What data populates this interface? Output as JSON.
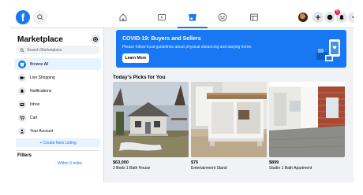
{
  "topbar": {
    "logo": "f",
    "nav_icons": [
      "home-icon",
      "watch-icon",
      "marketplace-icon",
      "groups-icon",
      "gaming-icon"
    ],
    "right_icons": [
      "plus-icon",
      "messenger-icon",
      "notifications-icon",
      "chevron-down-icon"
    ],
    "notification_count": "5"
  },
  "sidebar": {
    "title": "Marketplace",
    "search_placeholder": "Search Marketplace",
    "items": [
      {
        "label": "Browse All",
        "icon": "storefront-icon"
      },
      {
        "label": "Live Shopping",
        "icon": "live-icon"
      },
      {
        "label": "Notifications",
        "icon": "bell-icon"
      },
      {
        "label": "Inbox",
        "icon": "inbox-icon"
      },
      {
        "label": "Cart",
        "icon": "cart-icon"
      },
      {
        "label": "Your Account",
        "icon": "person-icon"
      }
    ],
    "create_label": "+ Create New Listing",
    "filters_label": "Filters",
    "location_filter": "· Within 5 miles"
  },
  "banner": {
    "title": "COVID-19: Buyers and Sellers",
    "text": "Please follow local guidelines about physical distancing and staying home.",
    "button": "Learn More"
  },
  "picks": {
    "title": "Today's Picks for You",
    "items": [
      {
        "price": "$63,000",
        "name": "2 Beds 1 Bath House"
      },
      {
        "price": "$75",
        "name": "Entertainment Stand"
      },
      {
        "price": "$899",
        "name": "Studio 1 Bath Apartment"
      }
    ]
  },
  "colors": {
    "accent": "#1877f2",
    "background": "#f0f2f5",
    "badge": "#e41e3f"
  }
}
